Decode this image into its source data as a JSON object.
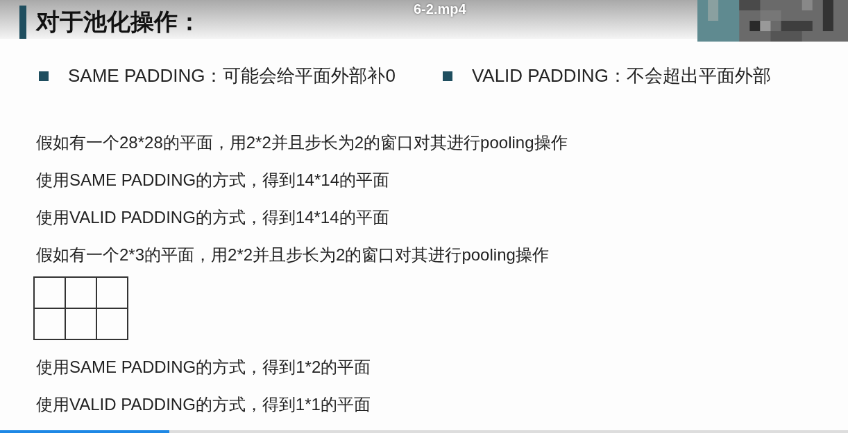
{
  "video": {
    "title": "6-2.mp4",
    "progress": {
      "level": 0.2
    }
  },
  "slide": {
    "heading": "对于池化操作：",
    "bullets": [
      "SAME PADDING：可能会给平面外部补0",
      "VALID PADDING：不会超出平面外部"
    ],
    "lines_before_grid": [
      "假如有一个28*28的平面，用2*2并且步长为2的窗口对其进行pooling操作",
      "使用SAME PADDING的方式，得到14*14的平面",
      "使用VALID PADDING的方式，得到14*14的平面",
      "假如有一个2*3的平面，用2*2并且步长为2的窗口对其进行pooling操作"
    ],
    "lines_after_grid": [
      "使用SAME PADDING的方式，得到1*2的平面",
      "使用VALID PADDING的方式，得到1*1的平面"
    ]
  }
}
